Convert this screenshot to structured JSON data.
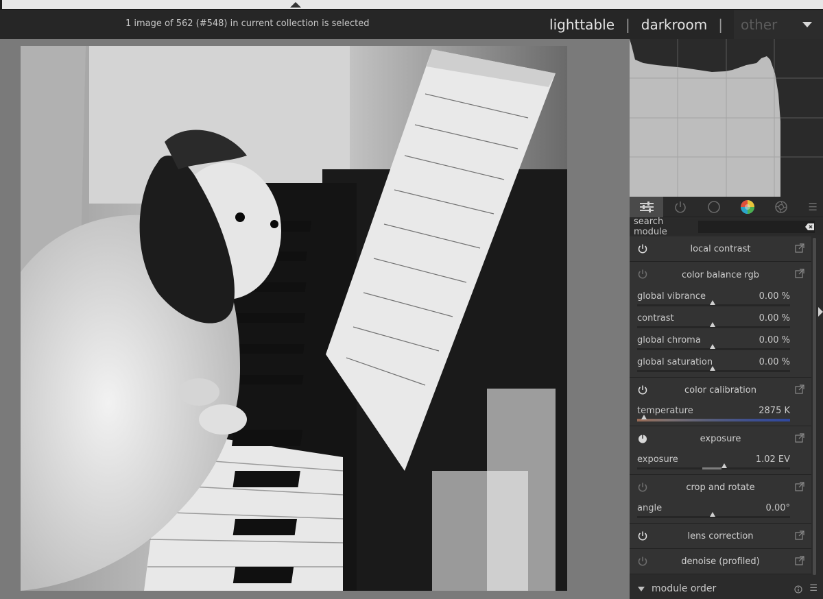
{
  "header": {
    "selection_status": "1 image of 562 (#548) in current collection is selected",
    "views": {
      "lighttable": "lighttable",
      "separator": "|",
      "darkroom": "darkroom",
      "other": "other"
    }
  },
  "panel_tabs": [
    {
      "icon": "sliders-icon",
      "active": true
    },
    {
      "icon": "power-icon"
    },
    {
      "icon": "circle-icon"
    },
    {
      "icon": "color-wheel-icon"
    },
    {
      "icon": "aperture-icon"
    },
    {
      "icon": "hamburger-menu-icon"
    }
  ],
  "search": {
    "label": "search module",
    "value": ""
  },
  "modules": {
    "local_contrast": {
      "name": "local contrast",
      "enabled": true
    },
    "color_balance": {
      "name": "color balance rgb",
      "enabled": false,
      "sliders": [
        {
          "label": "global vibrance",
          "value": "0.00 %"
        },
        {
          "label": "contrast",
          "value": "0.00 %"
        },
        {
          "label": "global chroma",
          "value": "0.00 %"
        },
        {
          "label": "global saturation",
          "value": "0.00 %"
        }
      ]
    },
    "color_calibration": {
      "name": "color calibration",
      "enabled": true,
      "temperature_label": "temperature",
      "temperature_value": "2875 K"
    },
    "exposure": {
      "name": "exposure",
      "enabled": true,
      "exposure_label": "exposure",
      "exposure_value": "1.02 EV"
    },
    "crop_rotate": {
      "name": "crop and rotate",
      "enabled": false,
      "angle_label": "angle",
      "angle_value": "0.00°"
    },
    "lens_correction": {
      "name": "lens correction",
      "enabled": true
    },
    "denoise": {
      "name": "denoise (profiled)",
      "enabled": false
    }
  },
  "module_order": {
    "label": "module order"
  },
  "colors": {
    "panel_bg": "#2b2b2b",
    "center_bg": "#7a7a7a",
    "module_bg": "#333333"
  }
}
